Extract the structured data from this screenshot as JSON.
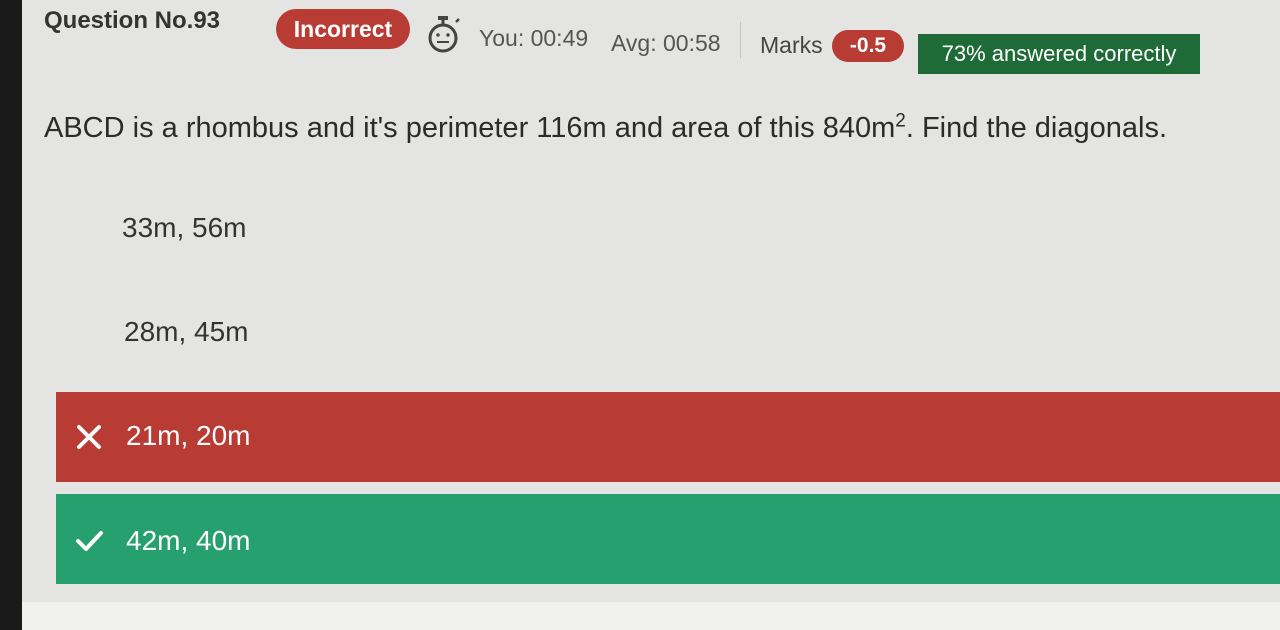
{
  "header": {
    "question_number": "Question No.93",
    "status": "Incorrect",
    "timer_icon": "stopwatch-icon",
    "you_time": "You: 00:49",
    "avg_time": "Avg: 00:58",
    "marks_label": "Marks",
    "marks_value": "-0.5",
    "answered_correctly": "73% answered correctly"
  },
  "question": {
    "text": "ABCD is a rhombus and it's perimeter 116m and area of this 840m",
    "superscript": "2",
    "text_end": ". Find the diagonals."
  },
  "options": [
    {
      "label": "33m, 56m",
      "state": "unselected"
    },
    {
      "label": "28m, 45m",
      "state": "unselected"
    },
    {
      "label": "21m, 20m",
      "state": "incorrect-selected",
      "icon": "cross-icon"
    },
    {
      "label": "42m, 40m",
      "state": "correct",
      "icon": "check-icon"
    }
  ],
  "colors": {
    "incorrect": "#b83b34",
    "correct": "#26a06f",
    "answered_badge": "#1f6b37",
    "background": "#e4e4e2"
  }
}
